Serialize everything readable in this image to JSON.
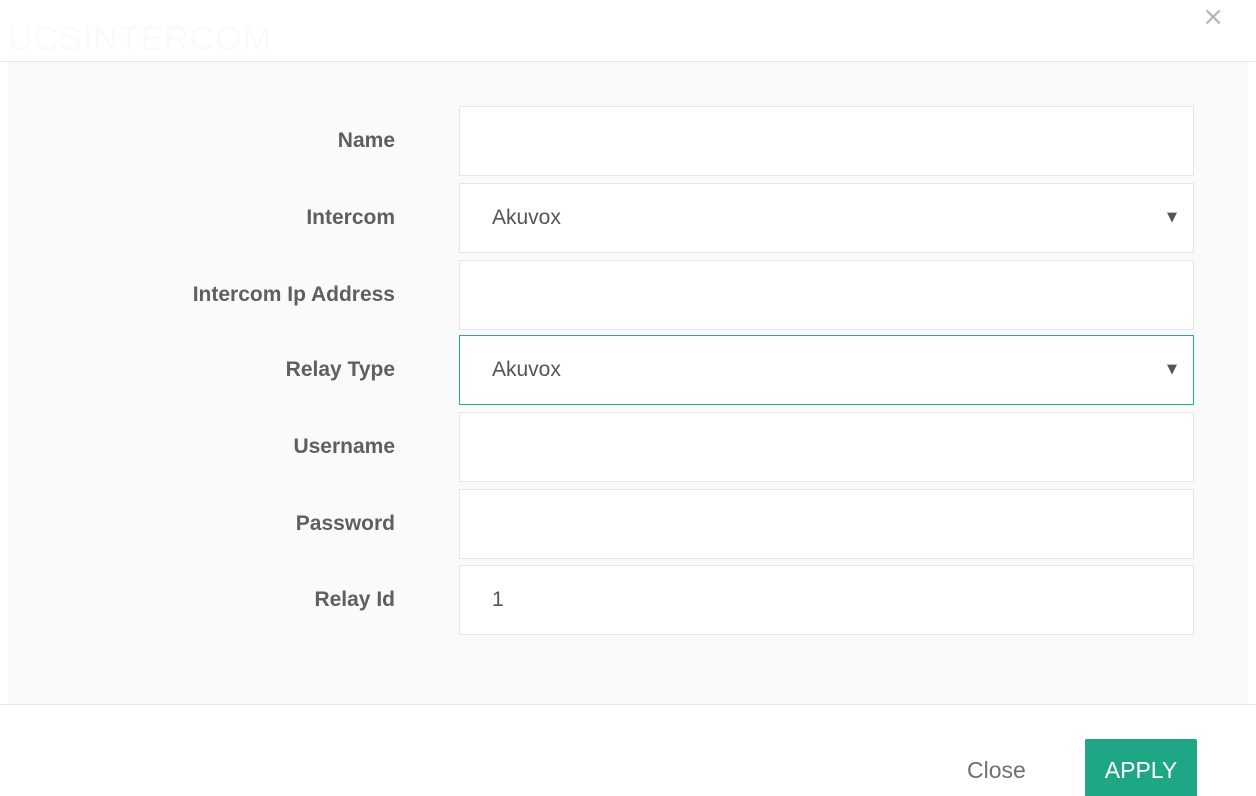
{
  "header": {
    "title": "UCSINTERCOM",
    "close_icon": "close-icon",
    "close_glyph": "×"
  },
  "form": {
    "fields": [
      {
        "label": "Name",
        "type": "text",
        "value": ""
      },
      {
        "label": "Intercom",
        "type": "select",
        "value": "Akuvox"
      },
      {
        "label": "Intercom Ip Address",
        "type": "text",
        "value": ""
      },
      {
        "label": "Relay Type",
        "type": "select",
        "value": "Akuvox",
        "focused": true
      },
      {
        "label": "Username",
        "type": "text",
        "value": ""
      },
      {
        "label": "Password",
        "type": "password",
        "value": ""
      },
      {
        "label": "Relay Id",
        "type": "text",
        "value": "1"
      }
    ],
    "select_arrow_glyph": "▼"
  },
  "footer": {
    "close_label": "Close",
    "apply_label": "APPLY"
  },
  "colors": {
    "accent": "#1fa785",
    "focus_border": "#1fb08e",
    "label_text": "#5f5f5f",
    "body_bg": "#fafafa"
  }
}
